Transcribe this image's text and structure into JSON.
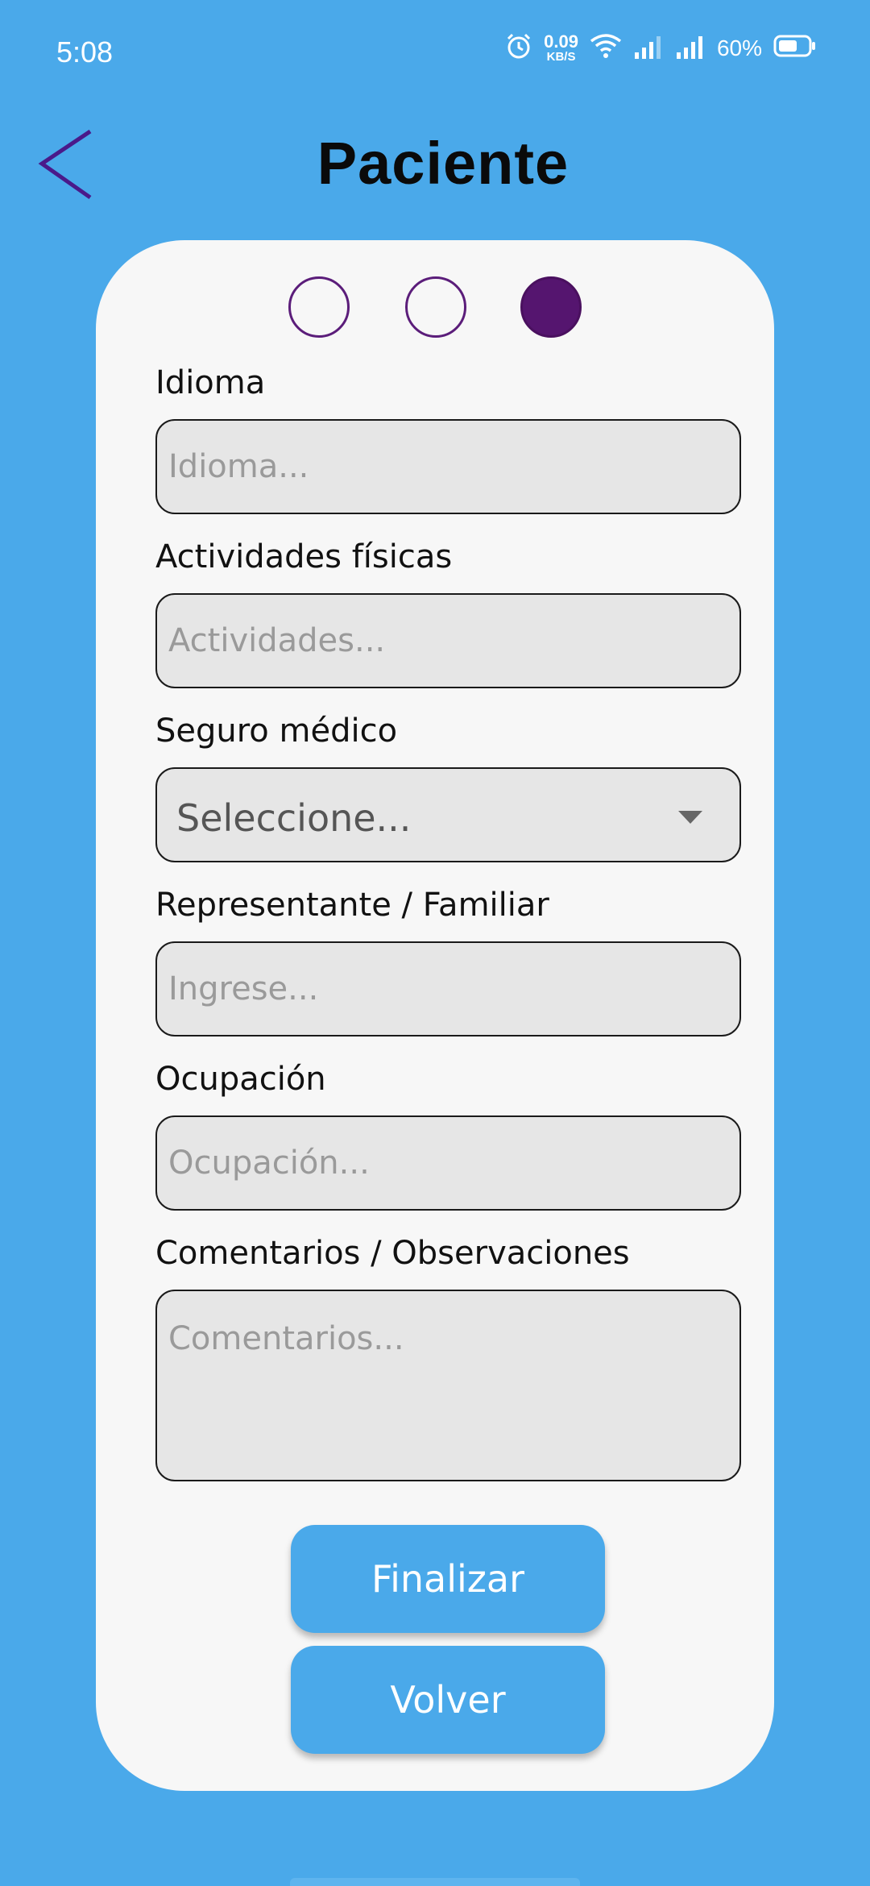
{
  "status_bar": {
    "time": "5:08",
    "net_speed_value": "0.09",
    "net_speed_unit": "KB/S",
    "battery_percent": "60%",
    "icons": [
      "alarm-icon",
      "wifi-icon",
      "signal-icon",
      "signal-icon",
      "battery-icon"
    ]
  },
  "header": {
    "title": "Paciente",
    "back_icon": "chevron-left-icon"
  },
  "stepper": {
    "steps": 3,
    "active_step": 3
  },
  "form": {
    "idioma": {
      "label": "Idioma",
      "placeholder": "Idioma...",
      "value": ""
    },
    "actividades": {
      "label": "Actividades físicas",
      "placeholder": "Actividades...",
      "value": ""
    },
    "seguro": {
      "label": "Seguro médico",
      "selected": "Seleccione..."
    },
    "representante": {
      "label": "Representante / Familiar",
      "placeholder": "Ingrese...",
      "value": ""
    },
    "ocupacion": {
      "label": "Ocupación",
      "placeholder": "Ocupación...",
      "value": ""
    },
    "comentarios": {
      "label": "Comentarios / Observaciones",
      "placeholder": "Comentarios...",
      "value": ""
    }
  },
  "buttons": {
    "finish": "Finalizar",
    "back": "Volver"
  },
  "colors": {
    "background": "#4aa9ea",
    "card": "#f7f7f7",
    "accent": "#55156f",
    "field": "#e6e6e6"
  }
}
